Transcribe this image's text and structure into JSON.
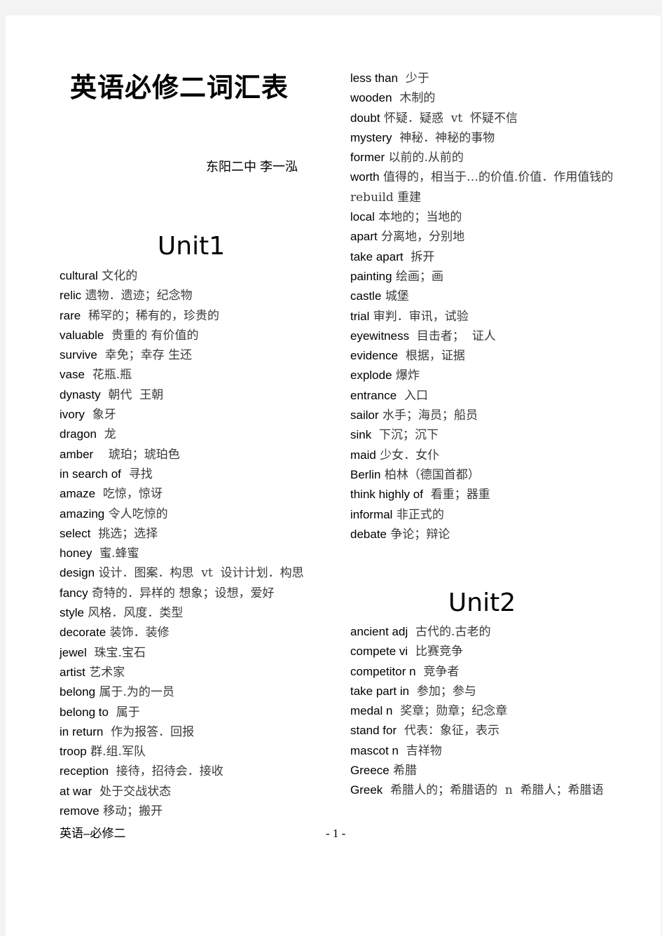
{
  "document": {
    "title": "英语必修二词汇表",
    "author": "东阳二中 李一泓",
    "footer_left": "英语–必修二",
    "page_number": "- 1 -"
  },
  "unit1": {
    "heading": "Unit1",
    "entries": [
      {
        "word": "cultural",
        "meaning": " 文化的"
      },
      {
        "word": "relic",
        "meaning": " 遗物．遗迹；纪念物"
      },
      {
        "word": "rare",
        "meaning": "  稀罕的；稀有的，珍贵的"
      },
      {
        "word": "valuable",
        "meaning": "  贵重的 有价值的"
      },
      {
        "word": "survive",
        "meaning": "  幸免；幸存 生还"
      },
      {
        "word": "vase",
        "meaning": "  花瓶.瓶"
      },
      {
        "word": "dynasty",
        "meaning": "  朝代  王朝"
      },
      {
        "word": "ivory",
        "meaning": "  象牙"
      },
      {
        "word": "dragon",
        "meaning": "  龙"
      },
      {
        "word": "amber",
        "meaning": "    琥珀；琥珀色"
      },
      {
        "word": "in search of",
        "meaning": "  寻找"
      },
      {
        "word": "amaze",
        "meaning": "  吃惊，惊讶"
      },
      {
        "word": "amazing",
        "meaning": " 令人吃惊的"
      },
      {
        "word": "select",
        "meaning": "  挑选；选择"
      },
      {
        "word": "honey",
        "meaning": "  蜜.蜂蜜"
      },
      {
        "word": "design",
        "meaning": " 设计．图案．构思  vt  设计计划．构思"
      },
      {
        "word": "fancy",
        "meaning": " 奇特的．异样的 想象；设想，爱好"
      },
      {
        "word": "style",
        "meaning": " 风格．风度．类型"
      },
      {
        "word": "decorate",
        "meaning": " 装饰．装修"
      },
      {
        "word": "jewel",
        "meaning": "  珠宝.宝石"
      },
      {
        "word": "artist",
        "meaning": " 艺术家"
      },
      {
        "word": "belong",
        "meaning": " 属于.为的一员"
      },
      {
        "word": "belong to",
        "meaning": "  属于"
      },
      {
        "word": "in return",
        "meaning": "  作为报答．回报"
      },
      {
        "word": "troop",
        "meaning": " 群.组.军队"
      },
      {
        "word": "reception",
        "meaning": "  接待，招待会．接收"
      },
      {
        "word": "at war",
        "meaning": "  处于交战状态"
      },
      {
        "word": "remove",
        "meaning": " 移动；搬开"
      }
    ]
  },
  "column2": {
    "entries": [
      {
        "word": "less than",
        "meaning": "  少于"
      },
      {
        "word": "wooden",
        "meaning": "  木制的"
      },
      {
        "word": "doubt",
        "meaning": " 怀疑．疑惑  vt  怀疑不信"
      },
      {
        "word": "mystery",
        "meaning": "  神秘．神秘的事物"
      },
      {
        "word": "former",
        "meaning": " 以前的.从前的"
      },
      {
        "word": "worth",
        "meaning": " 值得的，相当于…的价值.价值．作用值钱的 rebuild 重建"
      },
      {
        "word": "local",
        "meaning": " 本地的；当地的"
      },
      {
        "word": "apart",
        "meaning": " 分离地，分别地"
      },
      {
        "word": "take apart",
        "meaning": "  拆开"
      },
      {
        "word": "painting",
        "meaning": " 绘画；画"
      },
      {
        "word": "castle",
        "meaning": " 城堡"
      },
      {
        "word": "trial",
        "meaning": " 审判．审讯，试验"
      },
      {
        "word": "eyewitness",
        "meaning": "  目击者；  证人"
      },
      {
        "word": "evidence",
        "meaning": "  根据，证据"
      },
      {
        "word": "explode",
        "meaning": " 爆炸"
      },
      {
        "word": "entrance",
        "meaning": "  入口"
      },
      {
        "word": "sailor",
        "meaning": " 水手；海员；船员"
      },
      {
        "word": "sink",
        "meaning": "  下沉；沉下"
      },
      {
        "word": "maid",
        "meaning": " 少女．女仆"
      },
      {
        "word": "Berlin",
        "meaning": " 柏林（德国首都）"
      },
      {
        "word": "think highly of",
        "meaning": "  看重；器重"
      },
      {
        "word": "informal",
        "meaning": " 非正式的"
      },
      {
        "word": "debate",
        "meaning": " 争论；辩论"
      }
    ]
  },
  "unit2": {
    "heading": "Unit2",
    "entries": [
      {
        "word": "ancient adj",
        "meaning": "  古代的.古老的"
      },
      {
        "word": "compete vi",
        "meaning": "  比赛竞争"
      },
      {
        "word": "competitor n",
        "meaning": "  竞争者"
      },
      {
        "word": "take part in",
        "meaning": "  参加；参与"
      },
      {
        "word": "medal n",
        "meaning": "  奖章；勋章；纪念章"
      },
      {
        "word": "stand for",
        "meaning": "  代表：象征，表示"
      },
      {
        "word": "mascot n",
        "meaning": "  吉祥物"
      },
      {
        "word": "Greece",
        "meaning": " 希腊"
      },
      {
        "word": "Greek",
        "meaning": "  希腊人的；希腊语的  n  希腊人；希腊语"
      }
    ]
  }
}
